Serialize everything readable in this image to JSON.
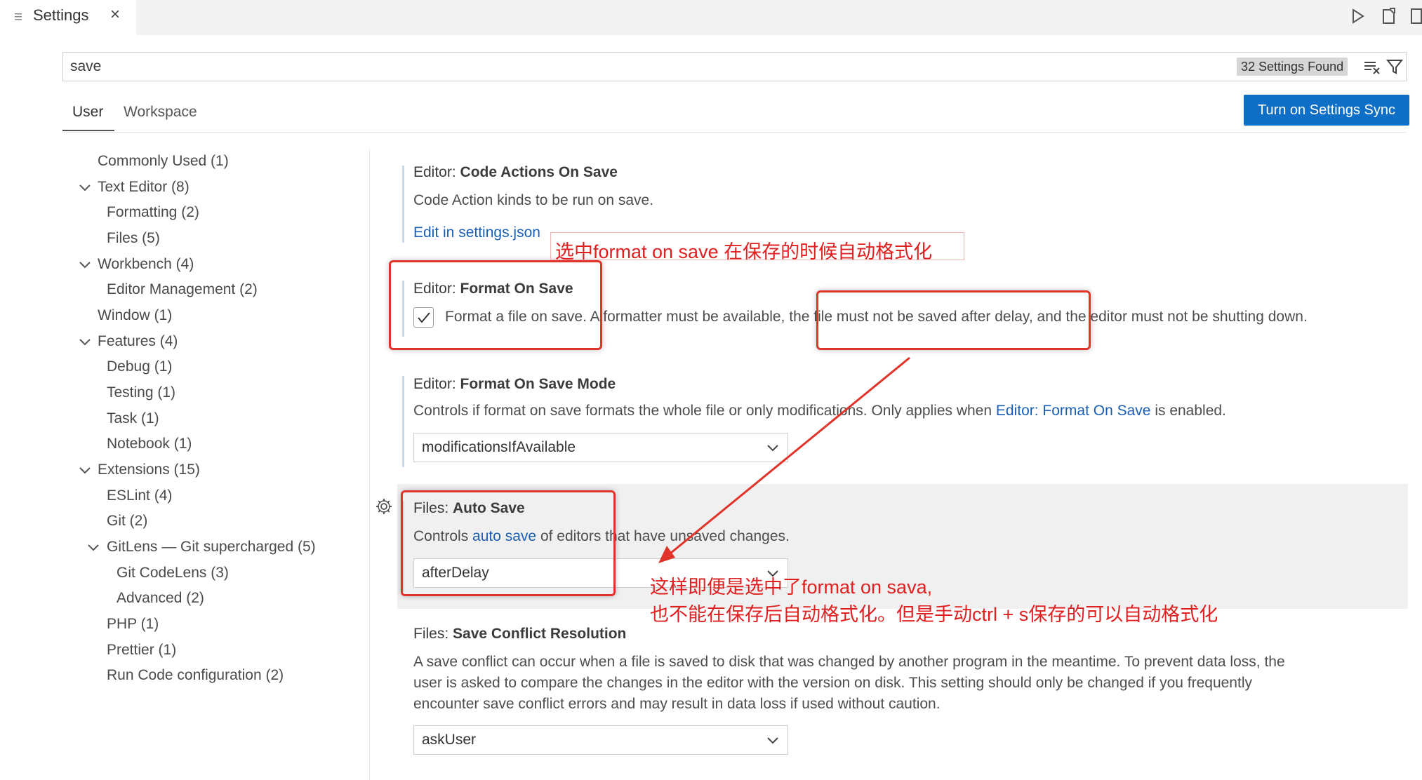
{
  "tab": {
    "label": "Settings",
    "close": "×"
  },
  "search": {
    "value": "save",
    "count": "32 Settings Found"
  },
  "scope": {
    "user": "User",
    "workspace": "Workspace"
  },
  "sync_button": "Turn on Settings Sync",
  "toc": [
    {
      "label": "Commonly Used (1)"
    },
    {
      "label": "Text Editor (8)"
    },
    {
      "label": "Formatting (2)"
    },
    {
      "label": "Files (5)"
    },
    {
      "label": "Workbench (4)"
    },
    {
      "label": "Editor Management (2)"
    },
    {
      "label": "Window (1)"
    },
    {
      "label": "Features (4)"
    },
    {
      "label": "Debug (1)"
    },
    {
      "label": "Testing (1)"
    },
    {
      "label": "Task (1)"
    },
    {
      "label": "Notebook (1)"
    },
    {
      "label": "Extensions (15)"
    },
    {
      "label": "ESLint (4)"
    },
    {
      "label": "Git (2)"
    },
    {
      "label": "GitLens — Git supercharged (5)"
    },
    {
      "label": "Git CodeLens (3)"
    },
    {
      "label": "Advanced (2)"
    },
    {
      "label": "PHP (1)"
    },
    {
      "label": "Prettier (1)"
    },
    {
      "label": "Run Code configuration (2)"
    }
  ],
  "settings": {
    "code_actions": {
      "category": "Editor: ",
      "name": "Code Actions On Save",
      "desc": "Code Action kinds to be run on save.",
      "link": "Edit in settings.json"
    },
    "format_on_save": {
      "category": "Editor: ",
      "name": "Format On Save",
      "desc": "Format a file on save. A formatter must be available, the file must not be saved after delay, and the editor must not be shutting down.",
      "checked": true
    },
    "format_on_save_mode": {
      "category": "Editor: ",
      "name": "Format On Save Mode",
      "desc_before": "Controls if format on save formats the whole file or only modifications. Only applies when ",
      "desc_link": "Editor: Format On Save",
      "desc_after": " is enabled.",
      "value": "modificationsIfAvailable"
    },
    "auto_save": {
      "category": "Files: ",
      "name": "Auto Save",
      "desc_before": "Controls ",
      "desc_link": "auto save",
      "desc_after": " of editors that have unsaved changes.",
      "value": "afterDelay"
    },
    "save_conflict": {
      "category": "Files: ",
      "name": "Save Conflict Resolution",
      "desc_line1": "A save conflict can occur when a file is saved to disk that was changed by another program in the meantime. To prevent data loss, the",
      "desc_line2": "user is asked to compare the changes in the editor with the version on disk. This setting should only be changed if you frequently",
      "desc_line3": "encounter save conflict errors and may result in data loss if used without caution.",
      "value": "askUser"
    }
  },
  "annotations": {
    "note1": "选中format on save 在保存的时候自动格式化",
    "note2_line1": "这样即便是选中了format on sava,",
    "note2_line2": "也不能在保存后自动格式化。但是手动ctrl + s保存的可以自动格式化",
    "color": "#e0332a"
  },
  "icons": [
    "list-icon",
    "close-icon",
    "run-icon",
    "open-json-icon",
    "split-editor-icon",
    "clear-filter-icon",
    "filter-icon",
    "gear-icon",
    "chevron-down-icon",
    "checkmark-icon"
  ]
}
